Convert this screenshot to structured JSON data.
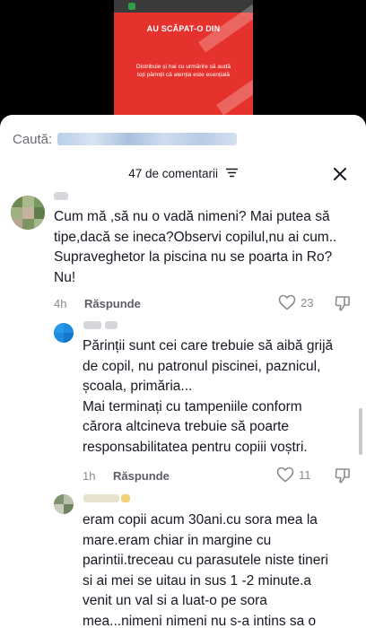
{
  "video": {
    "title": "AU SCĂPAT-O DIN",
    "caption_line1": "Distribuie și hai cu urmărire să audă",
    "caption_line2": "toți părinții că atenția este esențială",
    "accent": "#e5322d"
  },
  "search": {
    "label": "Caută:"
  },
  "header": {
    "title": "47 de comentarii",
    "filter_icon": "filter-lines-icon",
    "close_icon": "close-icon"
  },
  "comments": [
    {
      "lines": [
        "Cum mă ,să nu o vadă nimeni? Mai putea să",
        "tipe,dacă se ineca?Observi copilul,nu ai cum..",
        "Supraveghetor la piscina nu se poarta in Ro?",
        "Nu!"
      ],
      "time": "4h",
      "reply": "Răspunde",
      "likes": "23"
    },
    {
      "lines": [
        "Părinții sunt cei care trebuie să aibă grijă",
        "de copil, nu patronul piscinei, paznicul,",
        "școala, primăria...",
        "Mai terminați cu tampeniile conform",
        "cărora altcineva trebuie să poarte",
        "responsabilitatea pentru copiii voștri."
      ],
      "time": "1h",
      "reply": "Răspunde",
      "likes": "11"
    },
    {
      "lines": [
        "eram copii acum 30ani.cu sora mea la",
        "mare.eram chiar in margine cu",
        "parintii.treceau cu parasutele niste tineri",
        "si ai mei se uitau in sus 1 -2 minute.a",
        "venit un val si a luat-o pe sora",
        "mea...nimeni nimeni nu s-a intins sa o"
      ]
    }
  ]
}
